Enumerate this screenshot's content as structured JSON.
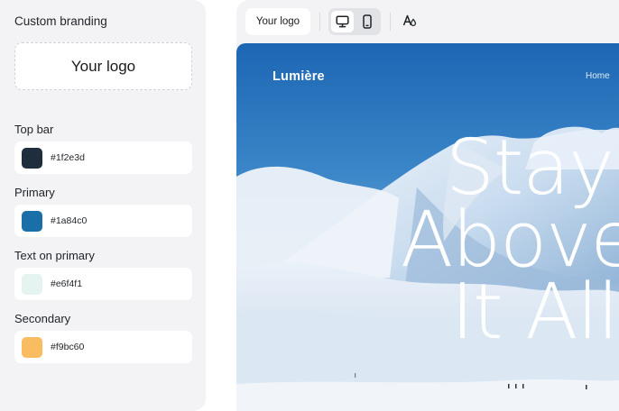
{
  "branding": {
    "title": "Custom branding",
    "logo_placeholder": "Your logo",
    "fields": [
      {
        "label": "Top bar",
        "hex": "#1f2e3d"
      },
      {
        "label": "Primary",
        "hex": "#1a84c0"
      },
      {
        "label": "Text on primary",
        "hex": "#e6f4f1"
      },
      {
        "label": "Secondary",
        "hex": "#f9bc60"
      }
    ]
  },
  "toolbar": {
    "logo_label": "Your logo",
    "device_selected": "desktop",
    "icons": [
      "desktop-icon",
      "mobile-icon",
      "font-color-icon"
    ]
  },
  "site": {
    "brand": "Lumière",
    "nav_home": "Home",
    "hero_lines": [
      "Stay",
      "Above",
      "It All"
    ]
  }
}
